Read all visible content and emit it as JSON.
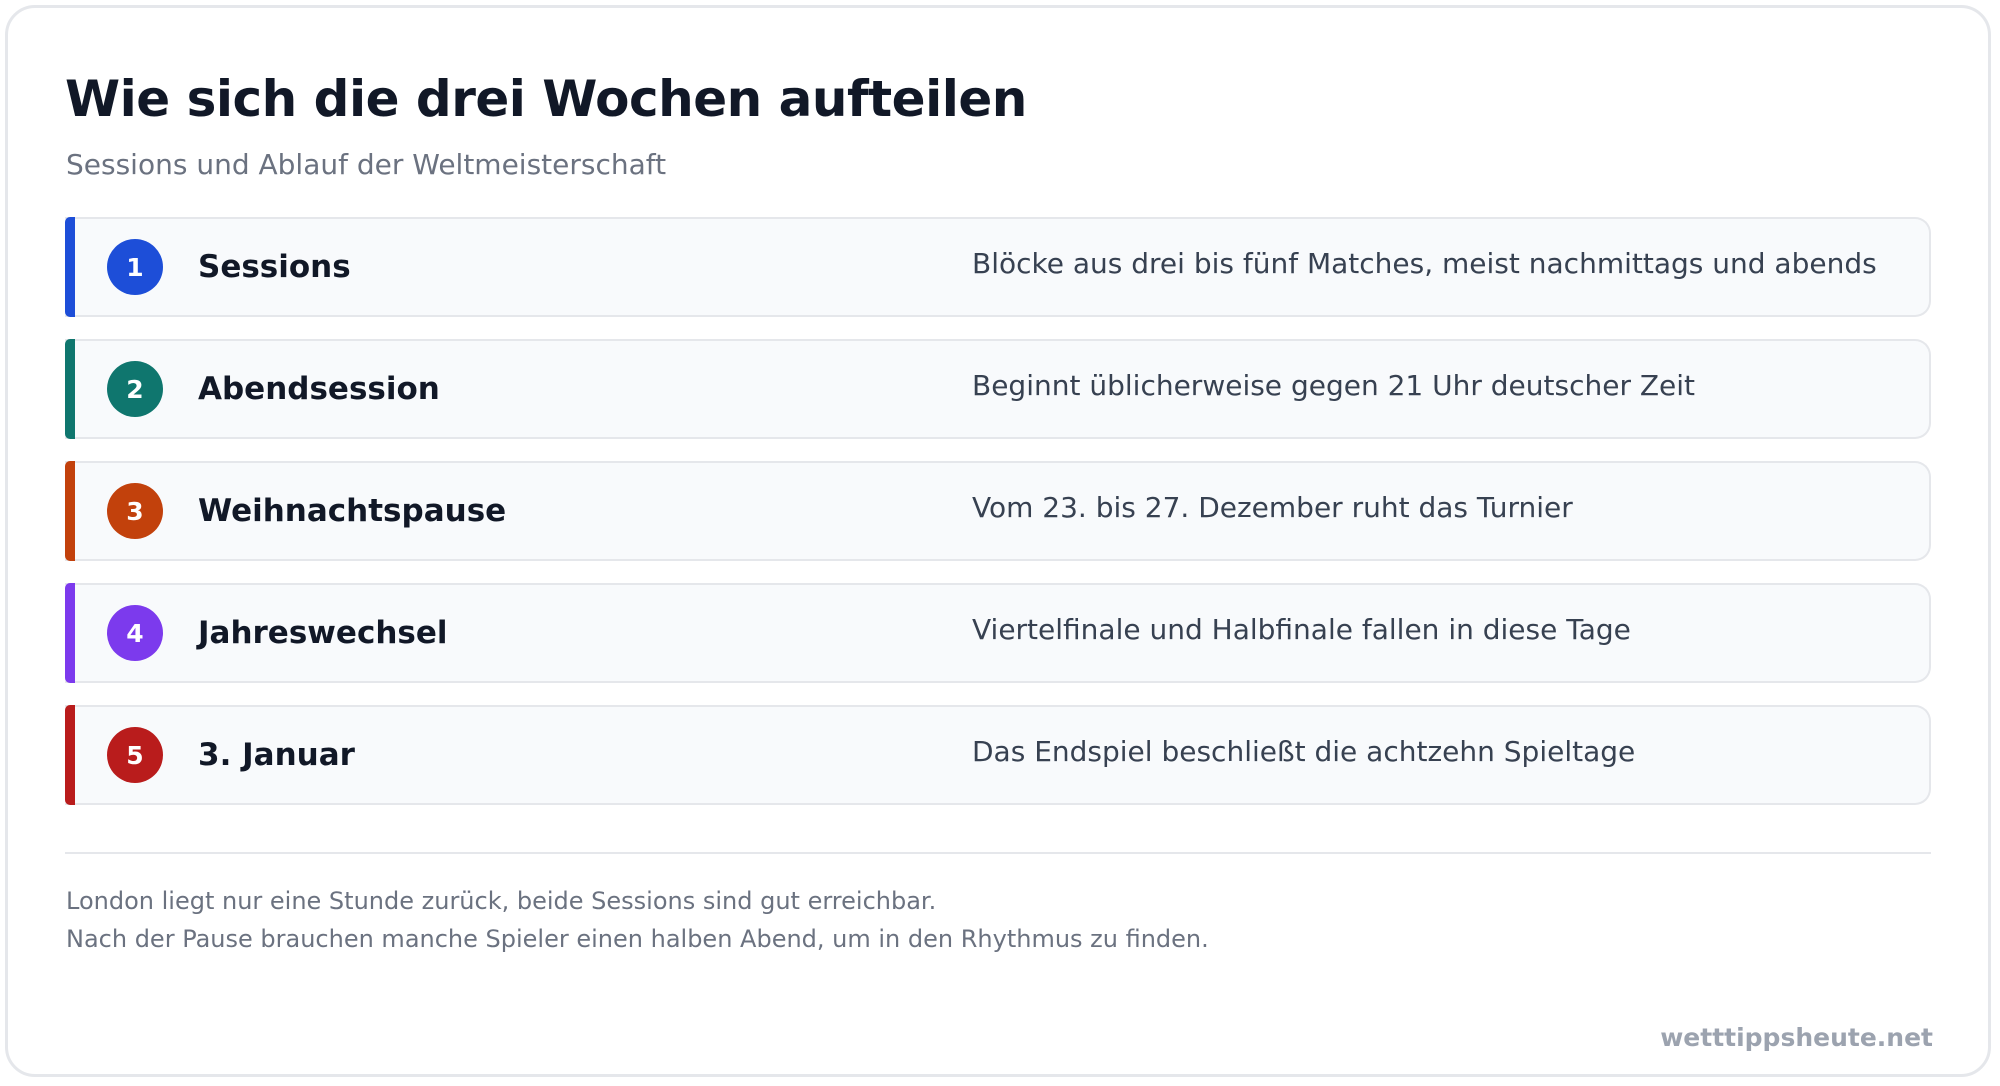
{
  "header": {
    "title": "Wie sich die drei Wochen aufteilen",
    "subtitle": "Sessions und Ablauf der Weltmeisterschaft"
  },
  "steps": [
    {
      "number": "1",
      "label": "Sessions",
      "description": "Blöcke aus drei bis fünf Matches, meist nachmittags und abends",
      "color": "#1d4ed8"
    },
    {
      "number": "2",
      "label": "Abendsession",
      "description": "Beginnt üblicherweise gegen 21 Uhr deutscher Zeit",
      "color": "#0f766e"
    },
    {
      "number": "3",
      "label": "Weihnachtspause",
      "description": "Vom 23. bis 27. Dezember ruht das Turnier",
      "color": "#c2410c"
    },
    {
      "number": "4",
      "label": "Jahreswechsel",
      "description": "Viertelfinale und Halbfinale fallen in diese Tage",
      "color": "#7c3aed"
    },
    {
      "number": "5",
      "label": "3. Januar",
      "description": "Das Endspiel beschließt die achtzehn Spieltage",
      "color": "#b91c1c"
    }
  ],
  "notes": {
    "line1": "London liegt nur eine Stunde zurück, beide Sessions sind gut erreichbar.",
    "line2": "Nach der Pause brauchen manche Spieler einen halben Abend, um in den Rhythmus zu finden."
  },
  "footer": {
    "brand": "wetttippsheute.net"
  }
}
